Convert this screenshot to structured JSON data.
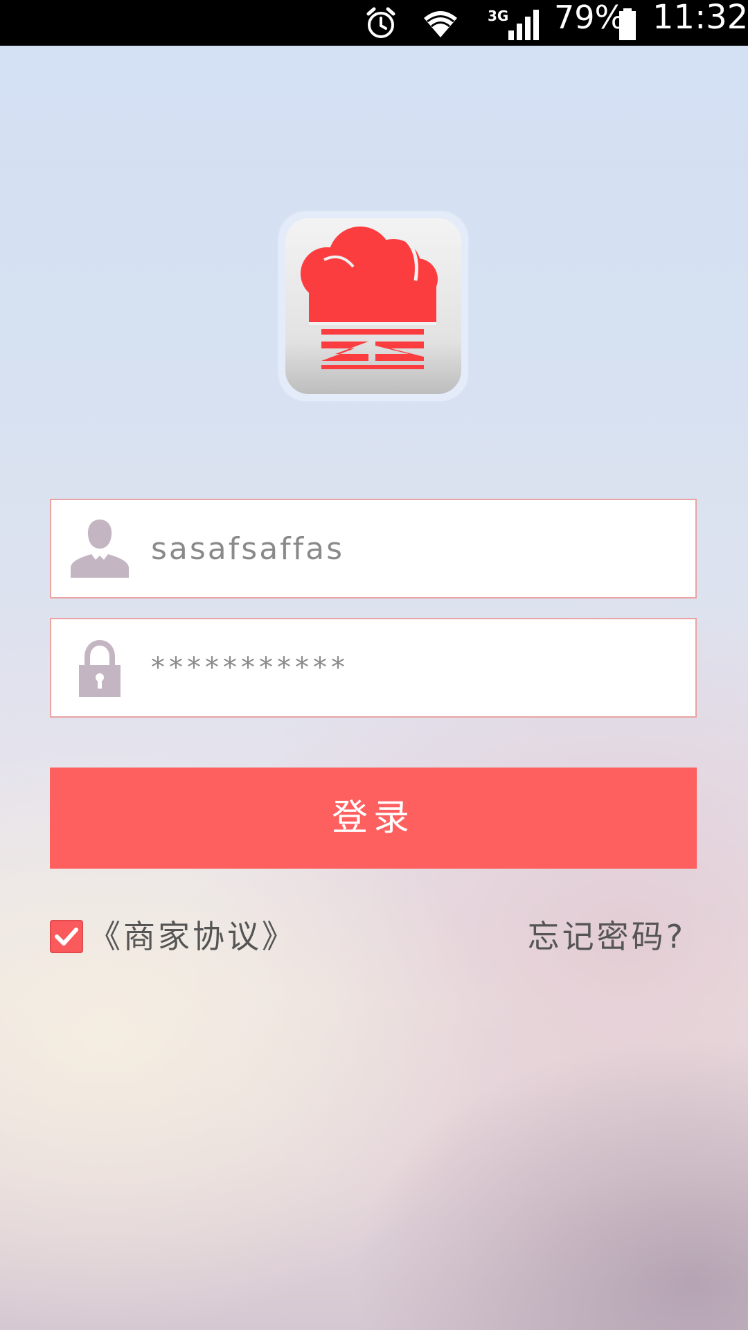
{
  "status_bar": {
    "network_type": "3G",
    "battery": "79%",
    "time": "11:32",
    "icons": [
      "alarm-icon",
      "wifi-icon",
      "signal-icon",
      "battery-icon"
    ]
  },
  "logo": {
    "icon": "chef-hat-icon",
    "brand_color": "#fb3d3f"
  },
  "login_form": {
    "username_value": "sasafsaffas",
    "password_value": "***********",
    "username_icon": "user-icon",
    "password_icon": "lock-icon",
    "login_label": "登录"
  },
  "footer": {
    "agreement_checked": true,
    "agreement_label": "《商家协议》",
    "forgot_password_label": "忘记密码?"
  },
  "colors": {
    "accent": "#fe5f5f",
    "field_border": "#e9a3a3",
    "icon_gray": "#c4b5c2"
  }
}
